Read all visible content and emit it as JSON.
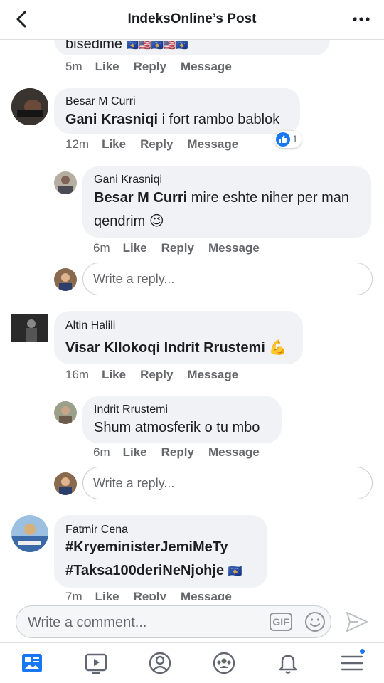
{
  "header": {
    "title": "IndeksOnline’s Post"
  },
  "top_partial": {
    "text_fragment": "bisedime",
    "time": "5m",
    "like": "Like",
    "reply": "Reply",
    "message": "Message"
  },
  "comments": [
    {
      "author": "Besar M Curri",
      "mention": "Gani Krasniqi",
      "text": " i fort rambo bablok",
      "time": "12m",
      "like": "Like",
      "reply": "Reply",
      "message": "Message",
      "reaction_count": "1"
    },
    {
      "author": "Gani Krasniqi",
      "mention": "Besar M Curri",
      "text": " mire eshte niher per man",
      "text2": "qendrim 😉",
      "time": "6m",
      "like": "Like",
      "reply": "Reply",
      "message": "Message"
    },
    {
      "author": "Altin Halili",
      "mention": "Visar Kllokoqi Indrit Rrustemi",
      "text": " 💪",
      "time": "16m",
      "like": "Like",
      "reply": "Reply",
      "message": "Message"
    },
    {
      "author": "Indrit Rrustemi",
      "text": "Shum atmosferik o tu mbo",
      "time": "6m",
      "like": "Like",
      "reply": "Reply",
      "message": "Message"
    },
    {
      "author": "Fatmir Cena",
      "line1": "#KryeministerJemiMeTy",
      "line2": "#Taksa100deriNeNjohje",
      "time": "7m",
      "like": "Like",
      "reply": "Reply",
      "message": "Message"
    }
  ],
  "reply_placeholder": "Write a reply...",
  "composer": {
    "placeholder": "Write a comment...",
    "gif_label": "GIF"
  },
  "tabs": [
    "news-feed-icon",
    "watch-icon",
    "profile-icon",
    "groups-icon",
    "notifications-icon",
    "menu-icon"
  ],
  "colors": {
    "accent": "#1877f2",
    "bubble": "#f0f2f5",
    "meta": "#65676b"
  }
}
